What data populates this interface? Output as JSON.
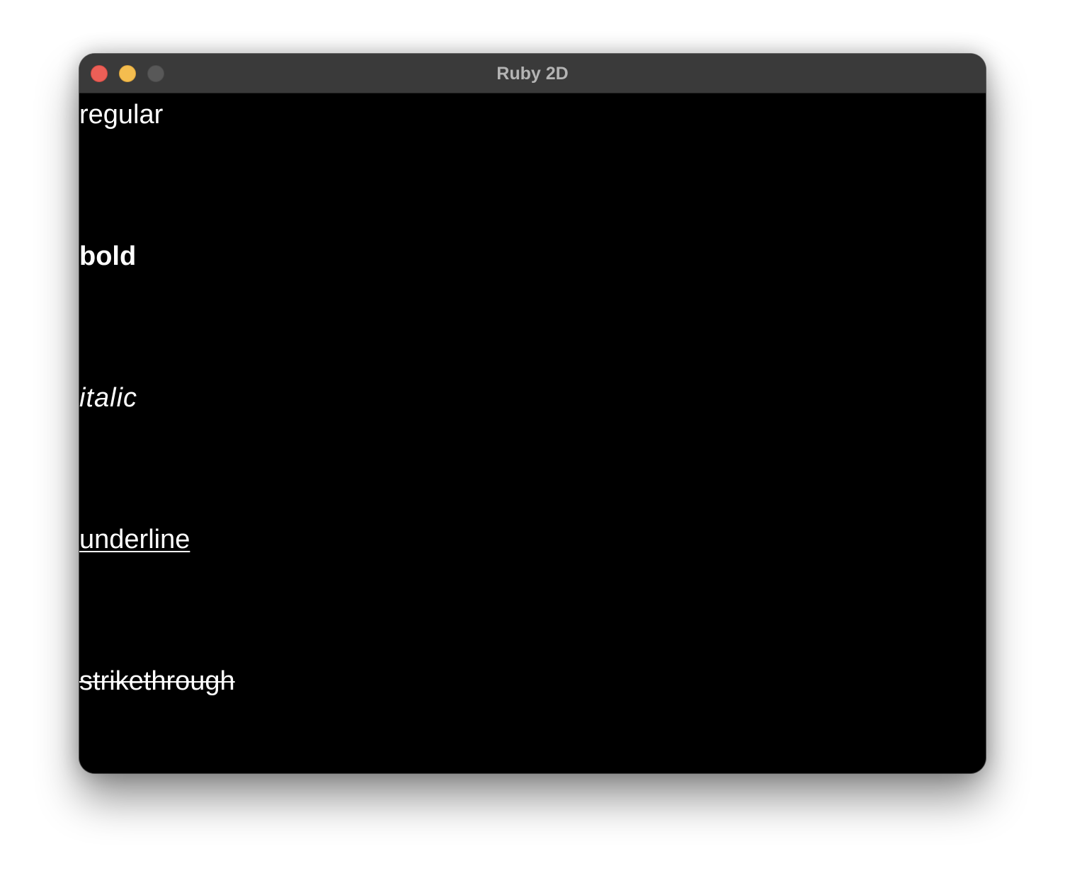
{
  "window": {
    "title": "Ruby 2D"
  },
  "colors": {
    "titlebar": "#3a3a3a",
    "canvas_background": "#000000",
    "text": "#ffffff",
    "close_button": "#ec5f57",
    "minimize_button": "#f4bd4f",
    "zoom_button": "#585858"
  },
  "canvas": {
    "samples": [
      {
        "text": "regular",
        "style": "regular"
      },
      {
        "text": "bold",
        "style": "bold"
      },
      {
        "text": "italic",
        "style": "italic"
      },
      {
        "text": "underline",
        "style": "underline"
      },
      {
        "text": "strikethrough",
        "style": "strikethrough"
      }
    ]
  }
}
